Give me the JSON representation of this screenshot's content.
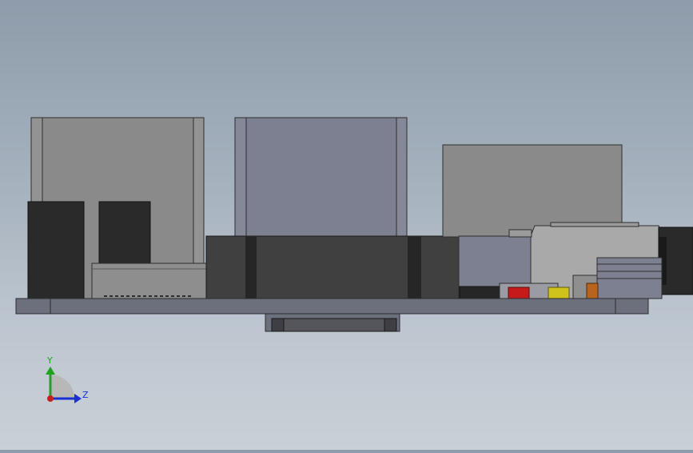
{
  "viewport": {
    "background_top": "#8e9cab",
    "background_bottom": "#c9d0d7"
  },
  "triad": {
    "y_label": "Y",
    "z_label": "Z",
    "y_color": "#1fa31f",
    "z_color": "#1a2fd6",
    "x_color": "#c81e1e"
  },
  "colors": {
    "board": "#6c6f7c",
    "dark_block": "#2a2a2a",
    "gray_block": "#8a8a8a",
    "blue_gray_block": "#7d8090",
    "connector_dark": "#404040",
    "red_part": "#c41a1a",
    "yellow_part": "#cfc21a",
    "orange_part": "#b8641c"
  }
}
